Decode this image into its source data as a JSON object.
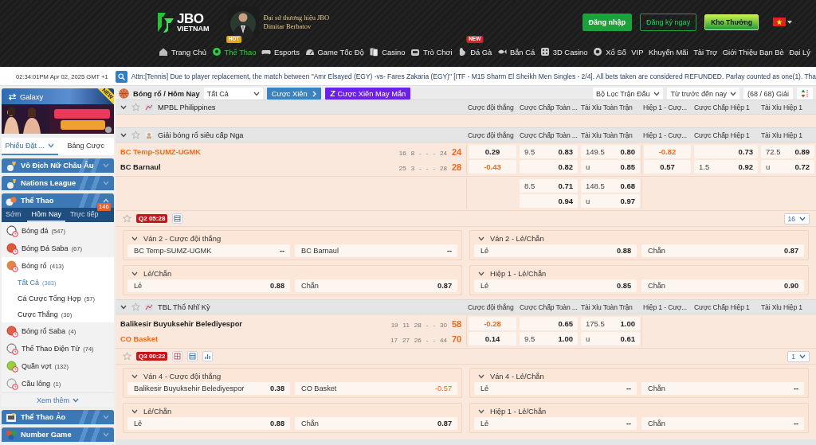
{
  "header": {
    "logo": {
      "title": "JBO",
      "subtitle": "VIETNAM"
    },
    "ambassador": {
      "caption": "Đại sứ thương hiệu JBO",
      "name": "Dimitar Berbatov"
    },
    "buttons": [
      {
        "label": "Đăng nhập",
        "kind": "login"
      },
      {
        "label": "Đăng ký ngay",
        "kind": "register"
      },
      {
        "label": "Kho Thưởng",
        "kind": "reward"
      }
    ],
    "nav": [
      {
        "label": "Trang Chủ",
        "selected": false
      },
      {
        "label": "Thể Thao",
        "selected": true,
        "badge": {
          "text": "HOT",
          "color": "#e8a317"
        }
      },
      {
        "label": "Esports",
        "selected": false
      },
      {
        "label": "Game Tốc Độ",
        "selected": false
      },
      {
        "label": "Casino",
        "selected": false
      },
      {
        "label": "Trò Chơi",
        "selected": false
      },
      {
        "label": "Đá Gà",
        "selected": false,
        "badge": {
          "text": "NEW",
          "color": "#e02020"
        }
      },
      {
        "label": "Bắn Cá",
        "selected": false
      },
      {
        "label": "3D Casino",
        "selected": false
      },
      {
        "label": "Xổ Số",
        "selected": false
      },
      {
        "label": "VIP",
        "selected": false
      },
      {
        "label": "Khuyến Mãi",
        "selected": false
      },
      {
        "label": "Tài Trợ",
        "selected": false
      },
      {
        "label": "Giới Thiệu Bạn Bè",
        "selected": false
      },
      {
        "label": "Đại Lý",
        "selected": false
      }
    ]
  },
  "ticker": {
    "time": "02:34:01PM Apr 02, 2025 GMT +1",
    "message": "Attn:[Tennis] Due to player replacement, the match between \"Amr Elsayed (EGY) -vs- Fares Zakaria (EGY)\" [ITF - M15 Sharm El Sheikh Men Singles - 2/4]. All bets taken are considered REFUNDED. Parlay counted as one(1). Tha"
  },
  "sidebar": {
    "galaxy": {
      "label": "Galaxy",
      "badge": "NEW"
    },
    "slip_tabs": [
      {
        "label": "Phiếu Đặt ...",
        "selected": true
      },
      {
        "label": "Bảng Cược",
        "selected": false
      }
    ],
    "sections": [
      {
        "title": "Vô Địch Nữ Châu Âu",
        "expanded": false
      },
      {
        "title": "Nations League",
        "expanded": false
      },
      {
        "title": "Thể Thao",
        "expanded": true,
        "tabs": [
          {
            "label": "Sớm",
            "selected": false
          },
          {
            "label": "Hôm Nay",
            "selected": true
          },
          {
            "label": "Trực tiếp",
            "selected": false,
            "badge": "146"
          }
        ],
        "sports": [
          {
            "name": "Bóng đá",
            "count": "(547)",
            "selected": false
          },
          {
            "name": "Bóng Đá Saba",
            "count": "(67)",
            "selected": false
          },
          {
            "name": "Bóng rổ",
            "count": "(413)",
            "selected": true,
            "children": [
              {
                "name": "Tất Cả",
                "count": "(383)",
                "selected": true
              },
              {
                "name": "Cá Cược Tổng Hợp",
                "count": "(57)",
                "selected": false
              },
              {
                "name": "Cược Thắng",
                "count": "(30)",
                "selected": false
              }
            ]
          },
          {
            "name": "Bóng rổ Saba",
            "count": "(4)",
            "selected": false
          },
          {
            "name": "Thể Thao Điện Tử",
            "count": "(74)",
            "selected": false
          },
          {
            "name": "Quần vợt",
            "count": "(132)",
            "selected": false
          },
          {
            "name": "Cầu lông",
            "count": "(1)",
            "selected": false
          }
        ],
        "more": "Xem thêm"
      },
      {
        "title": "Thể Thao Ảo",
        "expanded": false
      },
      {
        "title": "Number Game",
        "expanded": false
      }
    ]
  },
  "board": {
    "toolbar": {
      "breadcrumb": "Bóng rổ / Hôm Nay",
      "filter": "Tất Cả",
      "parlay": "Cược Xiên",
      "lucky_parlay": "Cược Xiên May Mắn",
      "match_filter": "Bộ Lọc Trận Đấu",
      "period": "Từ trước đến nay",
      "league_count": "(68 / 68) Giải"
    },
    "leagues": [
      {
        "name": "MPBL Philippines",
        "columns": [
          "Cược đội thắng",
          "Cược Chấp Toàn ...",
          "Tài Xỉu Toàn Trận",
          "Hiệp 1 - Cượ...",
          "Cược Chấp Hiệp 1",
          "Tài Xỉu Hiệp 1"
        ]
      },
      {
        "name": "Giải bóng rổ siêu cấp Nga",
        "columns": [
          "Cược đội thắng",
          "Cược Chấp Toàn ...",
          "Tài Xỉu Toàn Trận",
          "Hiệp 1 - Cượ...",
          "Cược Chấp Hiệp 1",
          "Tài Xỉu Hiệp 1"
        ],
        "matches": [
          {
            "teams": [
              {
                "name": "BC Temp-SUMZ-UGMK",
                "favorite": true,
                "scores": [
                  "16",
                  "8",
                  "-",
                  "-",
                  "-",
                  "24"
                ],
                "total": "24"
              },
              {
                "name": "BC Barnaul",
                "favorite": false,
                "scores": [
                  "25",
                  "3",
                  "-",
                  "-",
                  "-",
                  "28"
                ],
                "total": "28"
              }
            ],
            "lines": [
              [
                {
                  "moneyline": {
                    "price": "0.29",
                    "negative": false
                  },
                  "handicap": {
                    "line": "9.5",
                    "price": "0.83",
                    "negative": false
                  },
                  "total": {
                    "line": "149.5",
                    "price": "0.80",
                    "negative": false
                  },
                  "h1_moneyline": {
                    "price": "-0.82",
                    "negative": true
                  },
                  "h1_handicap": {
                    "price": "0.73",
                    "negative": false
                  },
                  "h1_total": {
                    "line": "72.5",
                    "price": "0.89",
                    "negative": false
                  }
                },
                {
                  "moneyline": {
                    "price": "-0.43",
                    "negative": true
                  },
                  "handicap": {
                    "price": "0.82",
                    "negative": false
                  },
                  "total": {
                    "line": "u",
                    "price": "0.85",
                    "negative": false
                  },
                  "h1_moneyline": {
                    "price": "0.57",
                    "negative": false
                  },
                  "h1_handicap": {
                    "line": "1.5",
                    "price": "0.92",
                    "negative": false
                  },
                  "h1_total": {
                    "line": "u",
                    "price": "0.72",
                    "negative": false
                  }
                }
              ],
              [
                {
                  "handicap": {
                    "line": "8.5",
                    "price": "0.71",
                    "negative": false
                  },
                  "total": {
                    "line": "148.5",
                    "price": "0.68",
                    "negative": false
                  }
                },
                {
                  "handicap": {
                    "price": "0.94",
                    "negative": false
                  },
                  "total": {
                    "line": "u",
                    "price": "0.97",
                    "negative": false
                  }
                }
              ]
            ],
            "live": {
              "period": "Q2",
              "clock": "05:28",
              "stats": false,
              "market_count": "16"
            },
            "markets": [
              {
                "title": "Ván 2 - Cược đội thắng",
                "options": [
                  {
                    "label": "BC Temp-SUMZ-UGMK",
                    "price": "--",
                    "negative": false
                  },
                  {
                    "label": "BC Barnaul",
                    "price": "--",
                    "negative": false
                  }
                ]
              },
              {
                "title": "Ván 2 - Lẻ/Chẵn",
                "options": [
                  {
                    "label": "Lẻ",
                    "price": "0.88",
                    "negative": false
                  },
                  {
                    "label": "Chẵn",
                    "price": "0.87",
                    "negative": false
                  }
                ]
              },
              {
                "title": "Lẻ/Chẵn",
                "options": [
                  {
                    "label": "Lẻ",
                    "price": "0.88",
                    "negative": false
                  },
                  {
                    "label": "Chẵn",
                    "price": "0.87",
                    "negative": false
                  }
                ]
              },
              {
                "title": "Hiệp 1 - Lẻ/Chẵn",
                "options": [
                  {
                    "label": "Lẻ",
                    "price": "0.85",
                    "negative": false
                  },
                  {
                    "label": "Chẵn",
                    "price": "0.90",
                    "negative": false
                  }
                ]
              }
            ]
          }
        ]
      },
      {
        "name": "TBL Thổ Nhĩ Kỳ",
        "columns": [
          "Cược đội thắng",
          "Cược Chấp Toàn ...",
          "Tài Xỉu Toàn Trận",
          "Hiệp 1 - Cượ...",
          "Cược Chấp Hiệp 1",
          "Tài Xỉu Hiệp 1"
        ],
        "matches": [
          {
            "teams": [
              {
                "name": "Balikesir Buyuksehir Belediyespor",
                "favorite": false,
                "scores": [
                  "19",
                  "11",
                  "28",
                  "-",
                  "-",
                  "30"
                ],
                "total": "58"
              },
              {
                "name": "CO Basket",
                "favorite": true,
                "scores": [
                  "17",
                  "27",
                  "26",
                  "-",
                  "-",
                  "44"
                ],
                "total": "70"
              }
            ],
            "lines": [
              [
                {
                  "moneyline": {
                    "price": "-0.28",
                    "negative": true
                  },
                  "handicap": {
                    "price": "0.65",
                    "negative": false
                  },
                  "total": {
                    "line": "175.5",
                    "price": "1.00",
                    "negative": false
                  }
                },
                {
                  "moneyline": {
                    "price": "0.14",
                    "negative": false
                  },
                  "handicap": {
                    "line": "9.5",
                    "price": "1.00",
                    "negative": false
                  },
                  "total": {
                    "line": "u",
                    "price": "0.61",
                    "negative": false
                  }
                }
              ]
            ],
            "live": {
              "period": "Q3",
              "clock": "00:22",
              "stats": true,
              "market_count": "1"
            },
            "markets": [
              {
                "title": "Ván 4 - Cược đội thắng",
                "options": [
                  {
                    "label": "Balikesir Buyuksehir Belediyespor",
                    "price": "0.38",
                    "negative": false
                  },
                  {
                    "label": "CO Basket",
                    "price": "-0.57",
                    "negative": true
                  }
                ]
              },
              {
                "title": "Ván 4 - Lẻ/Chẵn",
                "options": [
                  {
                    "label": "Lẻ",
                    "price": "--",
                    "negative": false
                  },
                  {
                    "label": "Chẵn",
                    "price": "--",
                    "negative": false
                  }
                ]
              },
              {
                "title": "Lẻ/Chẵn",
                "options": [
                  {
                    "label": "Lẻ",
                    "price": "0.88",
                    "negative": false
                  },
                  {
                    "label": "Chẵn",
                    "price": "0.87",
                    "negative": false
                  }
                ]
              },
              {
                "title": "Hiệp 1 - Lẻ/Chẵn",
                "options": [
                  {
                    "label": "Lẻ",
                    "price": "--",
                    "negative": false
                  },
                  {
                    "label": "Chẵn",
                    "price": "--",
                    "negative": false
                  }
                ]
              }
            ]
          }
        ]
      }
    ]
  }
}
